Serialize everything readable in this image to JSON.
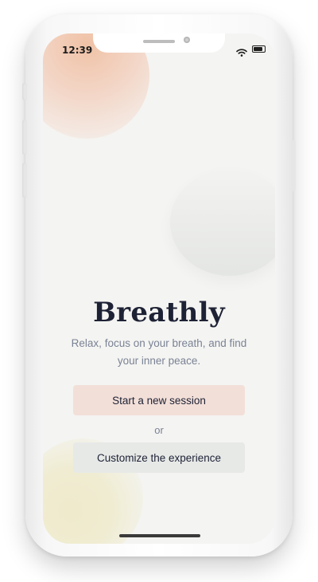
{
  "status_bar": {
    "time": "12:39",
    "icons": [
      "wifi-icon",
      "battery-icon"
    ]
  },
  "app": {
    "title": "Breathly",
    "subtitle": "Relax, focus on your breath, and find your inner peace."
  },
  "actions": {
    "start_label": "Start a new session",
    "or_label": "or",
    "customize_label": "Customize the experience"
  },
  "colors": {
    "background": "#f4f4f2",
    "title": "#1e2235",
    "subtitle": "#7a8294",
    "primary_button": "#f2dfd8",
    "secondary_button": "#e7e9e7",
    "accent_peach": "#f0c2a6",
    "accent_yellow": "#efeacb"
  }
}
